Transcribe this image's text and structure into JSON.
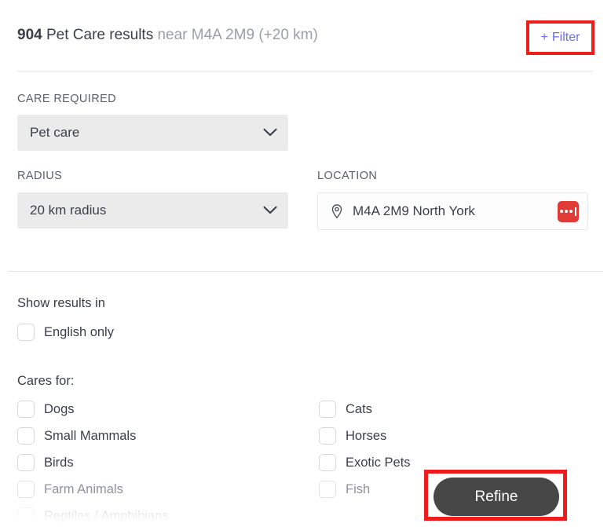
{
  "header": {
    "results_count": "904",
    "results_label": " Pet Care results",
    "results_near": "near M4A 2M9 (+20 km)",
    "filter_plus": "+",
    "filter_label": "Filter",
    "filter_color": "#6b6bf5",
    "annotation_color": "#ee1c1c"
  },
  "fields": {
    "care_required": {
      "label": "CARE REQUIRED",
      "value": "Pet care"
    },
    "radius": {
      "label": "RADIUS",
      "value": "20 km radius"
    },
    "location": {
      "label": "LOCATION",
      "value": "M4A 2M9 North York",
      "pin_icon": "map-pin-icon",
      "action_icon": "more-options-icon",
      "action_color": "#e03b37"
    }
  },
  "filters": {
    "show_results_label": "Show results in",
    "language_option": "English only",
    "cares_for_label": "Cares for:",
    "cares_left": [
      {
        "label": "Dogs",
        "fade": 0
      },
      {
        "label": "Small Mammals",
        "fade": 0
      },
      {
        "label": "Birds",
        "fade": 0
      },
      {
        "label": "Farm Animals",
        "fade": 1
      },
      {
        "label": "Reptiles / Amphibians",
        "fade": 2
      }
    ],
    "cares_right": [
      {
        "label": "Cats",
        "fade": 0
      },
      {
        "label": "Horses",
        "fade": 0
      },
      {
        "label": "Exotic Pets",
        "fade": 0
      },
      {
        "label": "Fish",
        "fade": 1
      }
    ]
  },
  "actions": {
    "refine_label": "Refine",
    "refine_bg": "#474747"
  }
}
